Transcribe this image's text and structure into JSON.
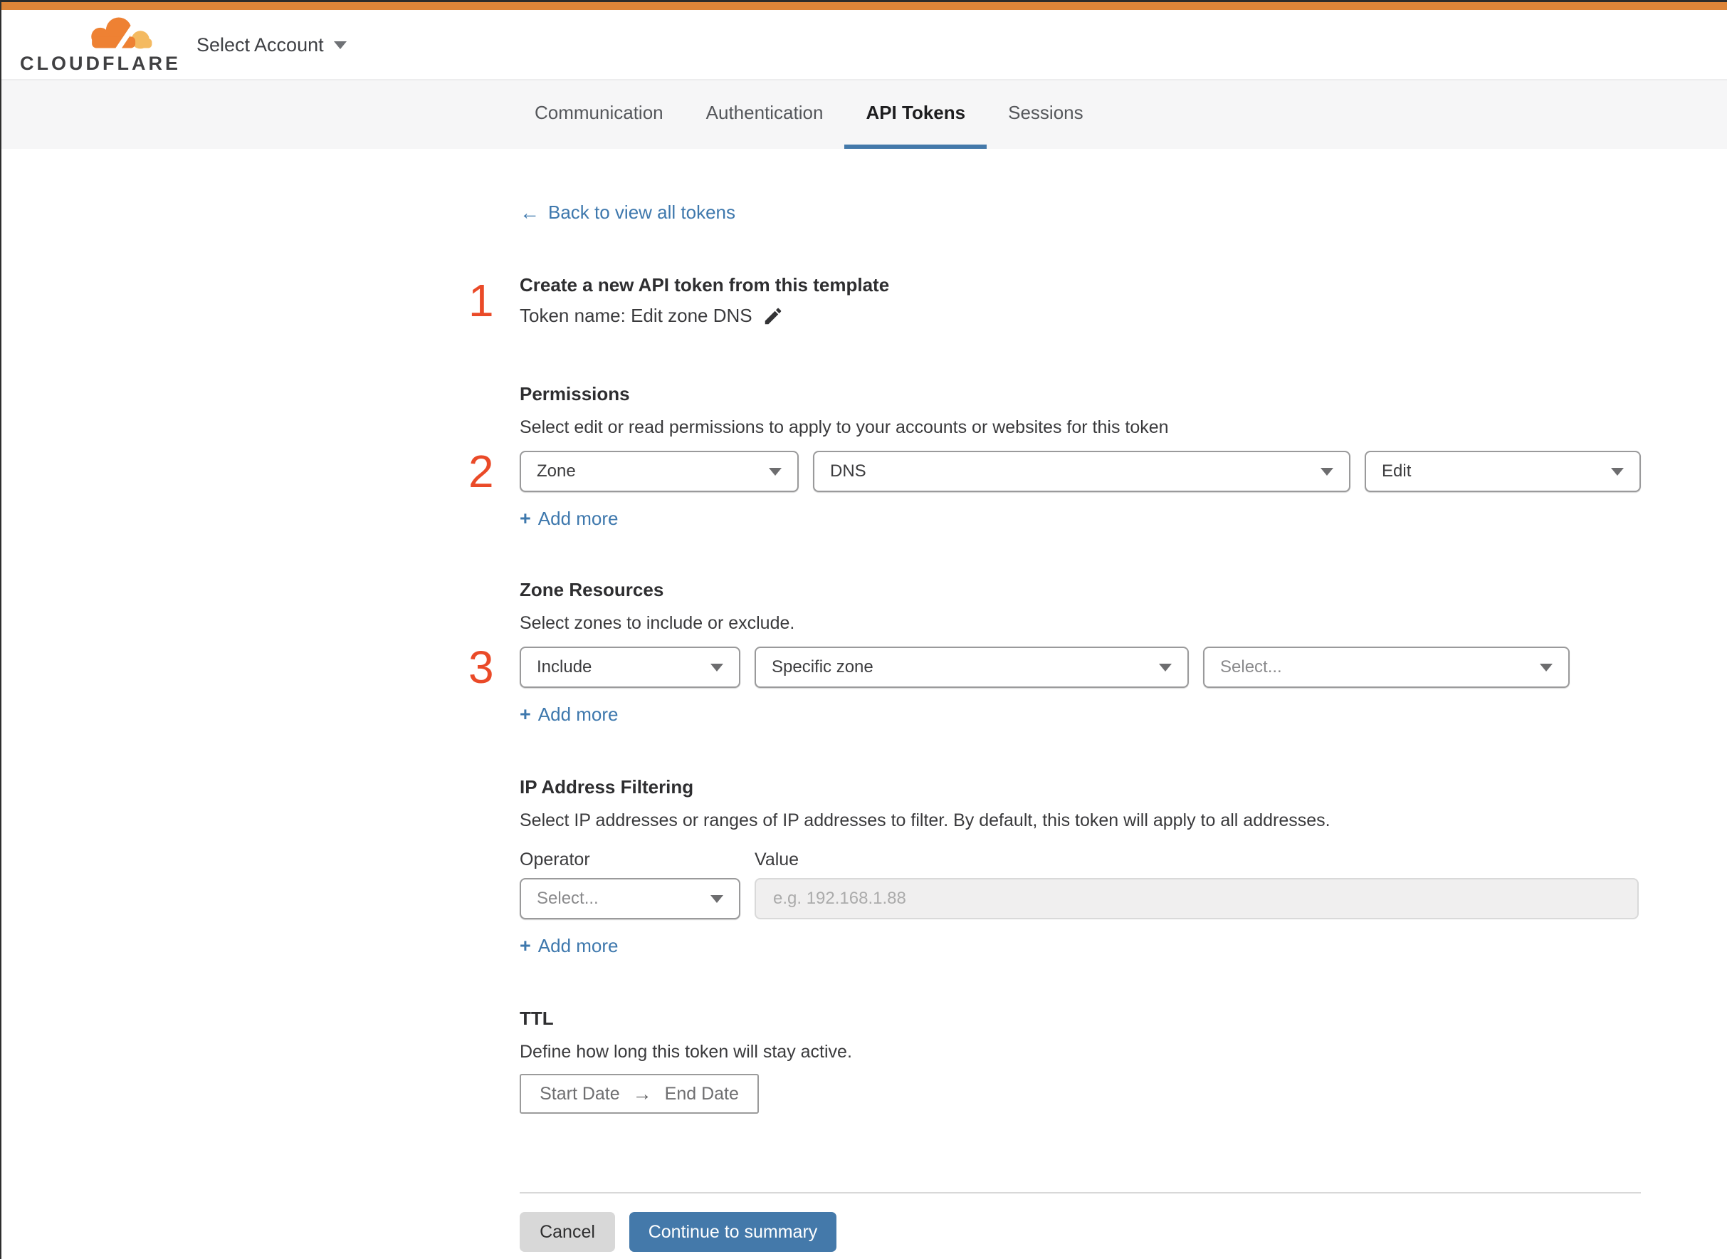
{
  "colors": {
    "brand_bar_orange": "#de8538",
    "logo_orange": "#ee8133",
    "logo_light_orange": "#f4ba61",
    "step_number_red": "#ea4a28",
    "link_blue": "#3e78ad",
    "active_tab_blue": "#4479aa",
    "continue_button_blue": "#4479aa"
  },
  "header": {
    "brand": "CLOUDFLARE",
    "account_selector": "Select Account"
  },
  "tabs": [
    {
      "label": "Communication",
      "active": false
    },
    {
      "label": "Authentication",
      "active": false
    },
    {
      "label": "API Tokens",
      "active": true
    },
    {
      "label": "Sessions",
      "active": false
    }
  ],
  "back": {
    "arrow": "←",
    "label": "Back to view all tokens"
  },
  "steps": [
    "1",
    "2",
    "3"
  ],
  "template_section": {
    "title": "Create a new API token from this template",
    "token_line": "Token name: Edit zone DNS"
  },
  "permissions": {
    "title": "Permissions",
    "description": "Select edit or read permissions to apply to your accounts or websites for this token",
    "scope_select": "Zone",
    "service_select": "DNS",
    "access_select": "Edit"
  },
  "zone_resources": {
    "title": "Zone Resources",
    "description": "Select zones to include or exclude.",
    "mode_select": "Include",
    "type_select": "Specific zone",
    "zone_select": "Select..."
  },
  "ip_filtering": {
    "title": "IP Address Filtering",
    "description": "Select IP addresses or ranges of IP addresses to filter. By default, this token will apply to all addresses.",
    "operator_label": "Operator",
    "value_label": "Value",
    "operator_select": "Select...",
    "value_placeholder": "e.g. 192.168.1.88"
  },
  "ttl": {
    "title": "TTL",
    "description": "Define how long this token will stay active.",
    "start_label": "Start Date",
    "arrow": "→",
    "end_label": "End Date"
  },
  "add_more": {
    "plus": "+",
    "label": "Add more"
  },
  "footer": {
    "cancel_label": "Cancel",
    "continue_label": "Continue to summary"
  }
}
